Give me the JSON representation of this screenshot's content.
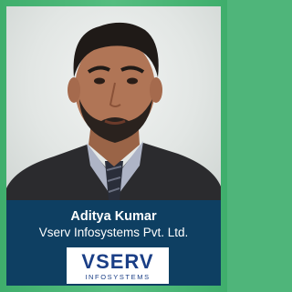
{
  "profile": {
    "name": "Aditya Kumar",
    "company": "Vserv Infosystems Pvt. Ltd."
  },
  "logo": {
    "word": "VSERV",
    "subtitle": "INFOSYSTEMS"
  },
  "colors": {
    "background_green": "#4fb57a",
    "panel_navy": "#0e3f62",
    "logo_blue": "#1a3e86"
  }
}
